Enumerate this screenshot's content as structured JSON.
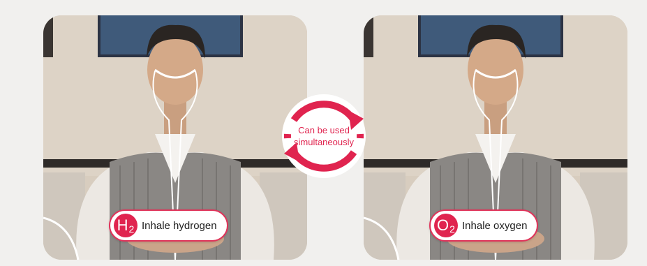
{
  "center_badge": {
    "line1": "Can be used",
    "line2": "simultaneously"
  },
  "left_panel": {
    "badge_symbol": "H",
    "badge_subscript": "2",
    "badge_label": "Inhale hydrogen"
  },
  "right_panel": {
    "badge_symbol": "O",
    "badge_subscript": "2",
    "badge_label": "Inhale oxygen"
  },
  "colors": {
    "accent": "#e0244f",
    "background": "#f1f0ee"
  },
  "icons": [
    "cycle-arrows-icon",
    "hydrogen-icon",
    "oxygen-icon"
  ]
}
